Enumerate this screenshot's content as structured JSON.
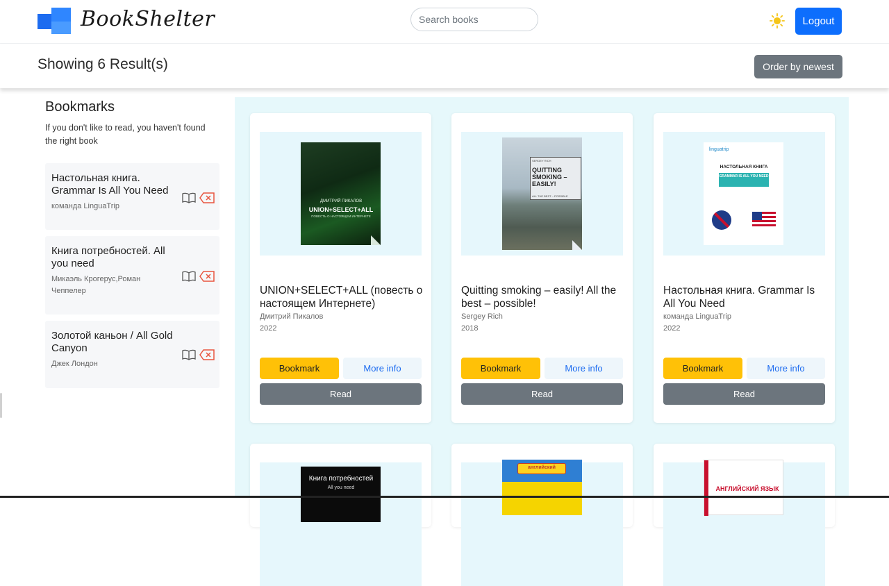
{
  "header": {
    "app_name": "BookShelter",
    "search_placeholder": "Search books",
    "logout_label": "Logout"
  },
  "toolbar": {
    "results_text": "Showing 6 Result(s)",
    "order_label": "Order by newest"
  },
  "sidebar": {
    "title": "Bookmarks",
    "subtitle": "If you don't like to read, you haven't found the right book",
    "items": [
      {
        "title": "Настольная книга. Grammar Is All You Need",
        "author": "команда LinguaTrip"
      },
      {
        "title": "Книга потребностей. All you need",
        "author": "Микаэль Крогерус,Роман Чеппелер"
      },
      {
        "title": "Золотой каньон / All Gold Canyon",
        "author": "Джек Лондон"
      }
    ]
  },
  "books": [
    {
      "title": "UNION+SELECT+ALL (повесть о настоящем Интернете)",
      "author": "Дмитрий Пикалов",
      "year": "2022",
      "cover_lines": [
        "ДМИТРИЙ ПИКАЛОВ",
        "UNION+SELECT+ALL",
        "ПОВЕСТЬ О НАСТОЯЩЕМ ИНТЕРНЕТЕ"
      ]
    },
    {
      "title": "Quitting smoking – easily! All the best – possible!",
      "author": "Sergey Rich",
      "year": "2018",
      "cover_lines": [
        "SERGEY RICH",
        "QUITTING SMOKING – EASILY!",
        "ALL THE BEST – POSSIBLE"
      ]
    },
    {
      "title": "Настольная книга. Grammar Is All You Need",
      "author": "команда LinguaTrip",
      "year": "2022",
      "cover_lines": [
        "linguatrip",
        "НАСТОЛЬНАЯ КНИГА",
        "GRAMMAR IS ALL YOU NEED"
      ]
    },
    {
      "cover_lines": [
        "Книга потребностей",
        "All you need"
      ]
    },
    {
      "cover_lines": [
        "английский"
      ]
    },
    {
      "cover_lines": [
        "АНГЛИЙСКИЙ ЯЗЫК"
      ]
    }
  ],
  "buttons": {
    "bookmark": "Bookmark",
    "more_info": "More info",
    "read": "Read"
  },
  "colors": {
    "primary": "#0d6efd",
    "secondary": "#6c757d",
    "bookmark": "#ffc107",
    "content_bg": "#e6f8fb"
  }
}
